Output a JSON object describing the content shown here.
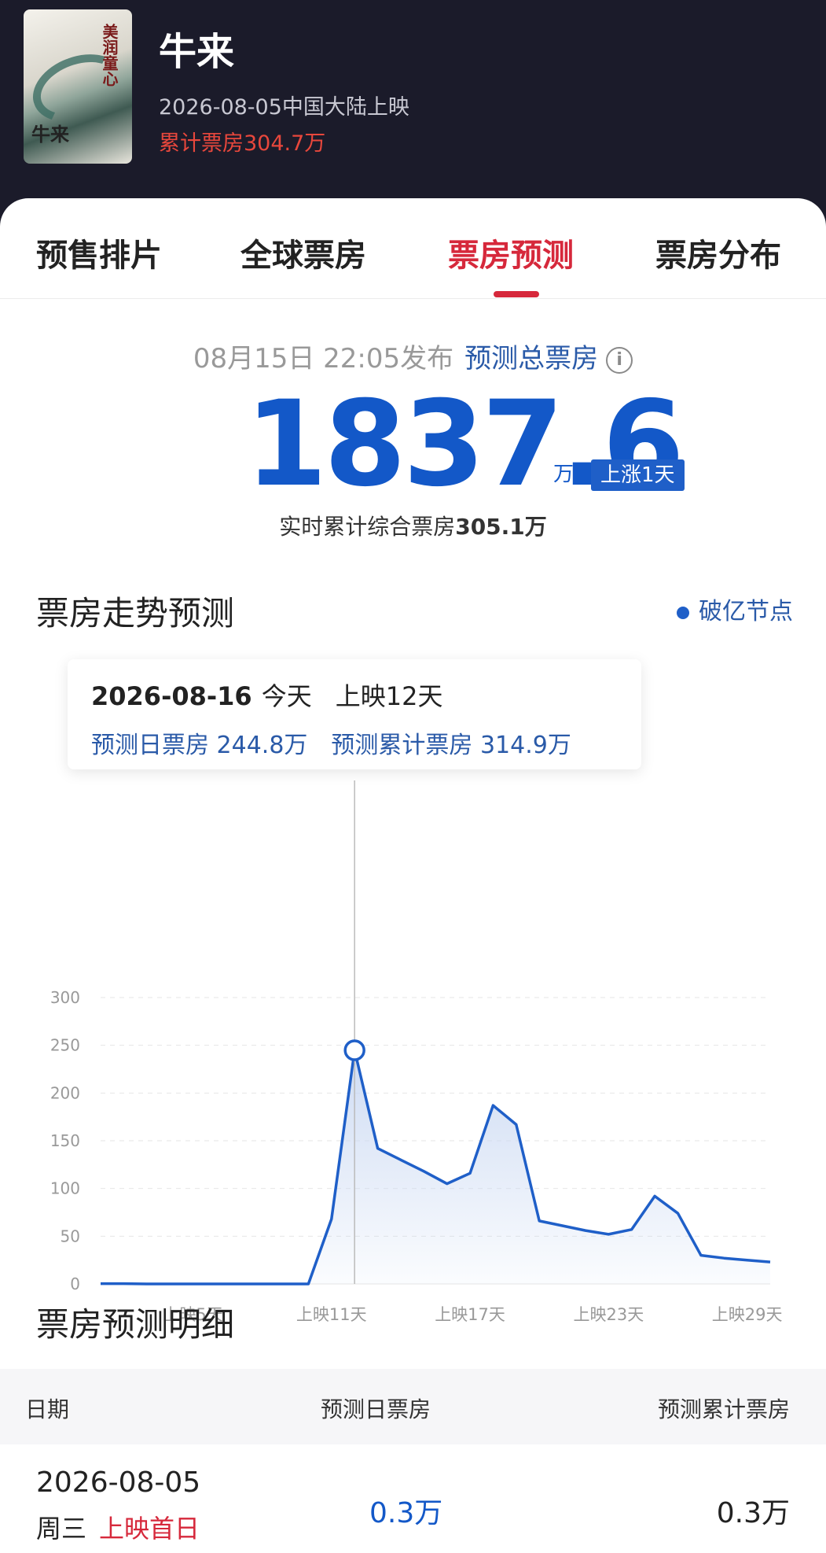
{
  "movie": {
    "title": "牛来",
    "release": "2026-08-05中国大陆上映",
    "cumulative": "累计票房304.7万",
    "poster": {
      "tagline": "美润童心",
      "title": "牛来"
    }
  },
  "tabs": [
    {
      "label": "预售排片",
      "active": false
    },
    {
      "label": "全球票房",
      "active": false
    },
    {
      "label": "票房预测",
      "active": true
    },
    {
      "label": "票房分布",
      "active": false
    }
  ],
  "forecast": {
    "publish_time": "08月15日 22:05发布",
    "label": "预测总票房",
    "total": "1837.6",
    "unit": "万",
    "rise_badge": "上涨1天",
    "realtime_prefix": "实时累计综合票房",
    "realtime_value": "305.1万"
  },
  "trend": {
    "title": "票房走势预测",
    "legend": "破亿节点",
    "tooltip": {
      "date": "2026-08-16",
      "today": "今天",
      "screening_prefix": "上映",
      "screening_days": "12天",
      "daily": "预测日票房 244.8万",
      "cumulative": "预测累计票房 314.9万"
    }
  },
  "chart_data": {
    "type": "area",
    "x_unit": "上映天数",
    "x": [
      1,
      2,
      3,
      4,
      5,
      6,
      7,
      8,
      9,
      10,
      11,
      12,
      13,
      14,
      15,
      16,
      17,
      18,
      19,
      20,
      21,
      22,
      23,
      24,
      25,
      26,
      27,
      28,
      29,
      30
    ],
    "values": [
      0.3,
      0.3,
      0,
      0,
      0,
      0,
      0,
      0,
      0,
      0,
      68,
      244.8,
      142,
      130,
      118,
      105,
      116,
      187,
      167,
      66,
      61,
      56,
      52,
      57,
      92,
      74,
      30,
      27,
      25,
      23
    ],
    "xticks": [
      {
        "x": 5,
        "label": "上映5天"
      },
      {
        "x": 11,
        "label": "上映11天"
      },
      {
        "x": 17,
        "label": "上映17天"
      },
      {
        "x": 23,
        "label": "上映23天"
      },
      {
        "x": 29,
        "label": "上映29天"
      }
    ],
    "yticks": [
      0,
      50,
      100,
      150,
      200,
      250,
      300
    ],
    "ylim": [
      0,
      300
    ],
    "highlight_x": 12,
    "colors": {
      "line": "#1f5fc8",
      "fill_top": "#c9d8f2",
      "grid": "#e6e6e6",
      "axis_text": "#999999"
    }
  },
  "detail": {
    "title": "票房预测明细",
    "headers": {
      "date": "日期",
      "daily": "预测日票房",
      "cumulative": "预测累计票房"
    },
    "rows": [
      {
        "date": "2026-08-05",
        "weekday": "周三",
        "note": "上映首日",
        "daily": "0.3万",
        "cumulative": "0.3万"
      }
    ]
  }
}
